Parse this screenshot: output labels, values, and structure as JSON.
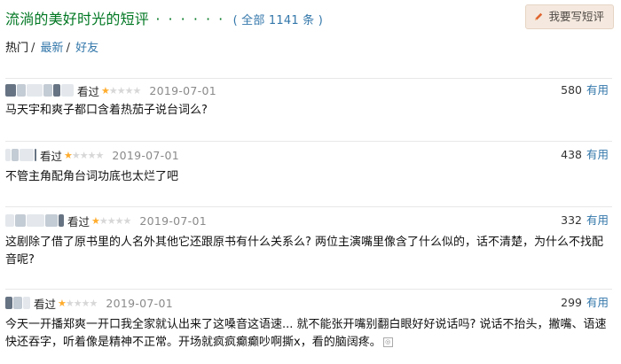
{
  "header": {
    "title": "流淌的美好时光的短评",
    "dots": "· · · · · ·",
    "count_open": "( 全部",
    "count_num": "1141",
    "count_close": "条 )",
    "write_button": "我要写短评"
  },
  "tabs": [
    {
      "label": "热门",
      "sep": "/"
    },
    {
      "label": "最新",
      "sep": "/"
    },
    {
      "label": "好友",
      "sep": ""
    }
  ],
  "reviews": [
    {
      "status": "看过",
      "rating": 1,
      "date": "2019-07-01",
      "votes": "580",
      "useful_label": "有用",
      "text": "马天宇和爽子都口含着热茄子说台词么?"
    },
    {
      "status": "看过",
      "rating": 1,
      "date": "2019-07-01",
      "votes": "438",
      "useful_label": "有用",
      "text": "不管主角配角台词功底也太烂了吧"
    },
    {
      "status": "看过",
      "rating": 1,
      "date": "2019-07-01",
      "votes": "332",
      "useful_label": "有用",
      "text": "这剧除了借了原书里的人名外其他它还跟原书有什么关系么? 两位主演嘴里像含了什么似的，话不清楚，为什么不找配音呢?"
    },
    {
      "status": "看过",
      "rating": 1,
      "date": "2019-07-01",
      "votes": "299",
      "useful_label": "有用",
      "text": "今天一开播郑爽一开口我全家就认出来了这嗓音这语速... 就不能张开嘴别翻白眼好好说话吗? 说话不抬头，撇嘴、语速快还吞字，听着像是精神不正常。开场就疯疯癫癫吵啊撕x，看的脑阔疼。"
    }
  ],
  "colors": {
    "title_green": "#007722",
    "link_blue": "#3377aa",
    "star": "#ffac2d",
    "button_bg": "#f5e9df"
  }
}
